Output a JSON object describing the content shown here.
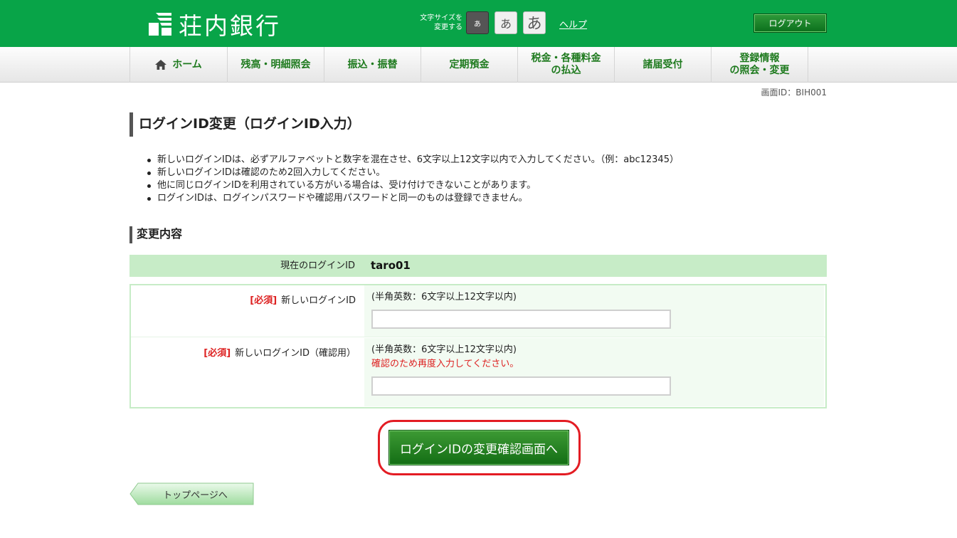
{
  "header": {
    "bank_name": "荘内銀行",
    "font_size_label_line1": "文字サイズを",
    "font_size_label_line2": "変更する",
    "font_small": "あ",
    "font_medium": "あ",
    "font_large": "あ",
    "help": "ヘルプ",
    "logout": "ログアウト",
    "accent_color": "#08a448"
  },
  "nav": {
    "items": [
      {
        "label": "ホーム",
        "icon": "home-icon"
      },
      {
        "label": "残高・明細照会"
      },
      {
        "label": "振込・振替"
      },
      {
        "label": "定期預金"
      },
      {
        "label_line1": "税金・各種料金",
        "label_line2": "の払込"
      },
      {
        "label": "諸届受付"
      },
      {
        "label_line1": "登録情報",
        "label_line2": "の照会・変更"
      }
    ]
  },
  "screen_id": "画面ID：BIH001",
  "page_title": "ログインID変更（ログインID入力）",
  "notes": [
    "新しいログインIDは、必ずアルファベットと数字を混在させ、6文字以上12文字以内で入力してください。（例：abc12345）",
    "新しいログインIDは確認のため2回入力してください。",
    "他に同じログインIDを利用されている方がいる場合は、受け付けできないことがあります。",
    "ログインIDは、ログインパスワードや確認用パスワードと同一のものは登録できません。"
  ],
  "section_title": "変更内容",
  "current": {
    "label": "現在のログインID",
    "value": "taro01"
  },
  "form": {
    "required_mark": "[必須]",
    "new_id_label": "新しいログインID",
    "new_id_hint": "(半角英数：6文字以上12文字以内)",
    "new_id_value": "",
    "confirm_label": "新しいログインID（確認用）",
    "confirm_hint": "(半角英数：6文字以上12文字以内)",
    "confirm_note": "確認のため再度入力してください。",
    "confirm_value": ""
  },
  "submit_button": "ログインIDの変更確認画面へ",
  "top_page_button": "トップページへ"
}
